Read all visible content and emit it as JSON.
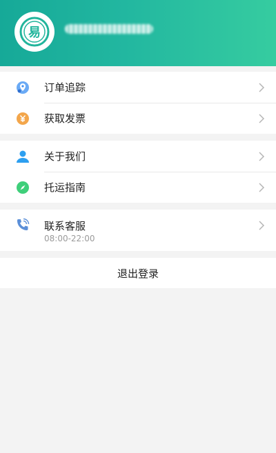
{
  "header": {
    "username": "",
    "username_blurred": true,
    "gradient_colors": [
      "#16a998",
      "#36cca0"
    ],
    "avatar_icon": "yi-logo-icon"
  },
  "menu": {
    "groups": [
      {
        "items": [
          {
            "label": "订单追踪",
            "icon": "location-pin-icon",
            "icon_color": "#3f8ef0"
          },
          {
            "label": "获取发票",
            "icon": "yuan-coin-icon",
            "icon_color": "#f3a64b"
          }
        ]
      },
      {
        "items": [
          {
            "label": "关于我们",
            "icon": "user-icon",
            "icon_color": "#2d9ff0"
          },
          {
            "label": "托运指南",
            "icon": "compass-icon",
            "icon_color": "#3fcf7a"
          }
        ]
      },
      {
        "items": [
          {
            "label": "联系客服",
            "icon": "phone-call-icon",
            "icon_color": "#5b8fd8",
            "subtitle": "08:00-22:00"
          }
        ]
      }
    ]
  },
  "logout_label": "退出登录"
}
